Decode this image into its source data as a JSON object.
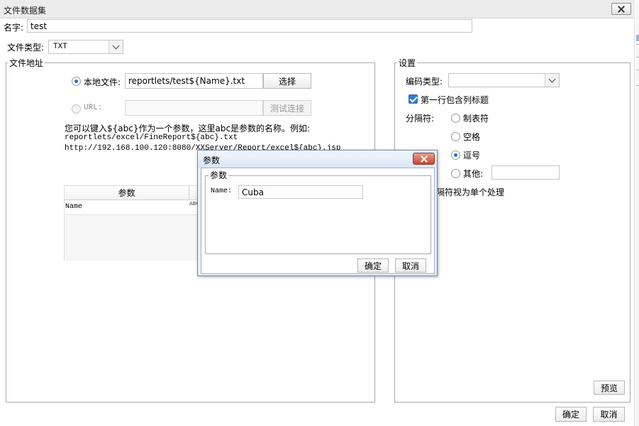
{
  "window": {
    "title": "文件数据集"
  },
  "name_row": {
    "label": "名字:",
    "value": "test"
  },
  "file_type": {
    "label": "文件类型:",
    "selected": "TXT"
  },
  "file_address": {
    "group_label": "文件地址",
    "local_file_label": "本地文件:",
    "local_file_path": "reportlets/test${Name}.txt",
    "select_button": "选择",
    "url_label": "URL:",
    "url_value": "",
    "test_connection_button": "测试连接",
    "help_line1": "您可以键入${abc}作为一个参数，这里abc是参数的名称。例如:",
    "help_line2": "reportlets/excel/FineReport${abc}.txt",
    "help_line3": "http://192.168.100.120:8080/XXServer/Report/excel${abc}.jsp"
  },
  "param_table": {
    "header_param": "参数",
    "row_name": "Name",
    "row_icon_text": "ABC"
  },
  "settings": {
    "group_label": "设置",
    "encoding_label": "编码类型:",
    "encoding_value": "",
    "first_row_header": "第一行包含列标题",
    "delimiter_label": "分隔符:",
    "opt_tab": "制表符",
    "opt_space": "空格",
    "opt_comma": "逗号",
    "opt_other": "其他:",
    "other_value": "",
    "merge_delims": "分隔符视为单个处理",
    "preview_button": "预览"
  },
  "footer": {
    "ok": "确定",
    "cancel": "取消"
  },
  "dialog": {
    "title": "参数",
    "group_label": "参数",
    "name_label": "Name:",
    "name_value": "Cuba",
    "ok": "确定",
    "cancel": "取消"
  }
}
